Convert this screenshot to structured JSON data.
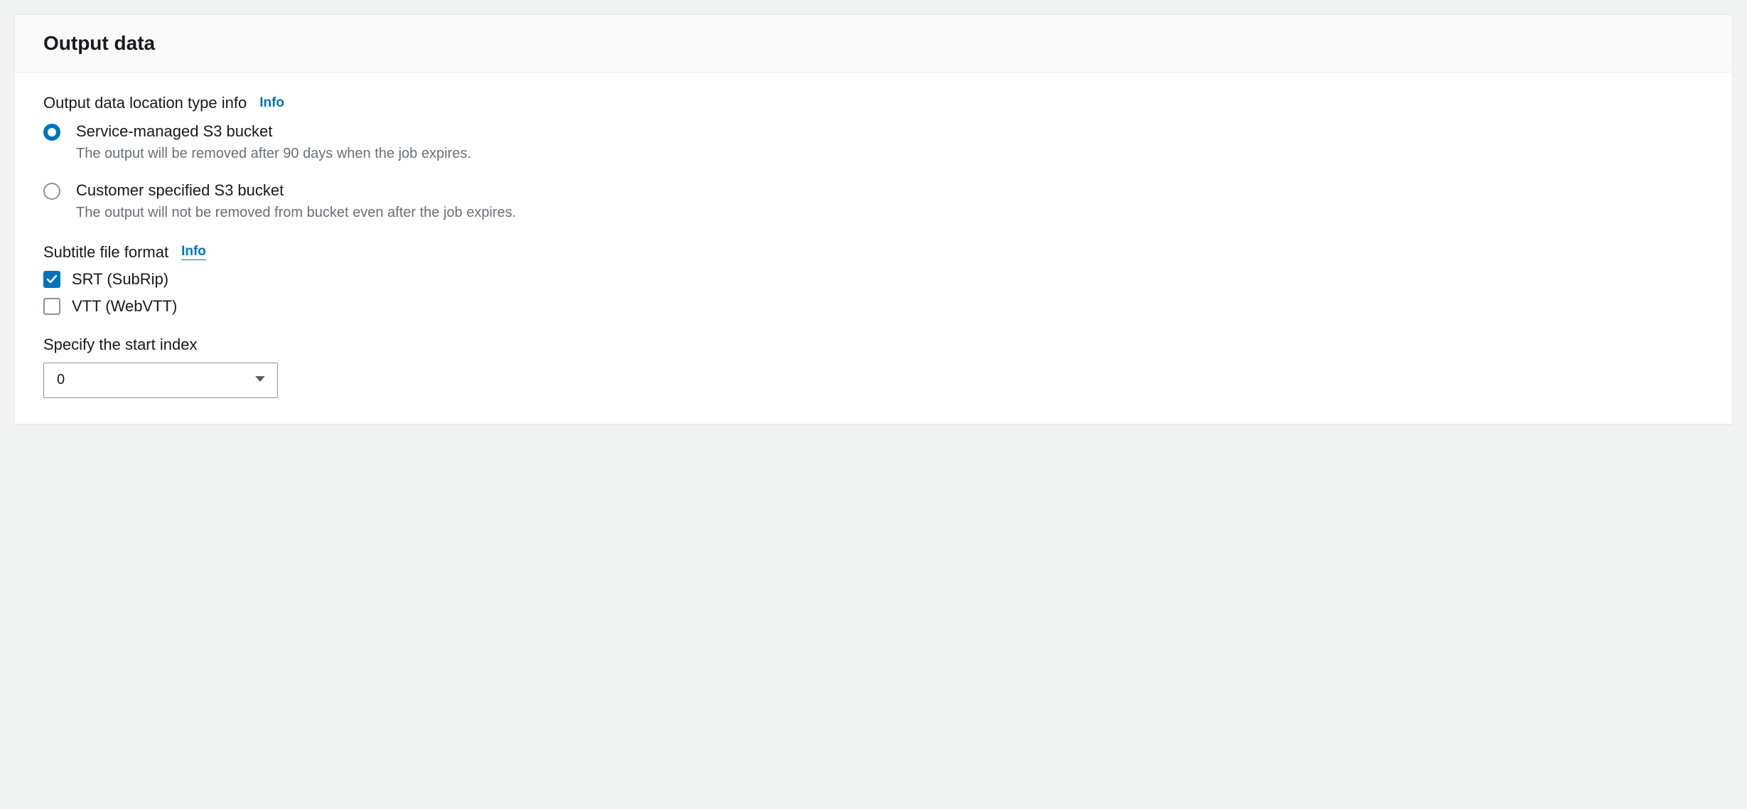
{
  "panel": {
    "title": "Output data"
  },
  "outputLocation": {
    "label": "Output data location type info",
    "infoLabel": "Info",
    "options": [
      {
        "title": "Service-managed S3 bucket",
        "desc": "The output will be removed after 90 days when the job expires.",
        "selected": true
      },
      {
        "title": "Customer specified S3 bucket",
        "desc": "The output will not be removed from bucket even after the job expires.",
        "selected": false
      }
    ]
  },
  "subtitleFormat": {
    "label": "Subtitle file format",
    "infoLabel": "Info",
    "options": [
      {
        "label": "SRT (SubRip)",
        "checked": true
      },
      {
        "label": "VTT (WebVTT)",
        "checked": false
      }
    ]
  },
  "startIndex": {
    "label": "Specify the start index",
    "value": "0"
  }
}
